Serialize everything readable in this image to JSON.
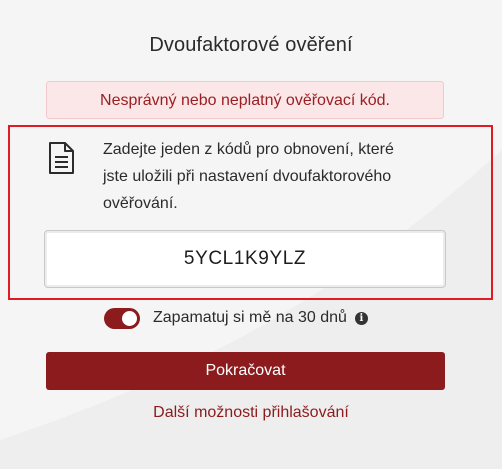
{
  "page": {
    "title": "Dvoufaktorové ověření"
  },
  "alert": {
    "error_text": "Nesprávný nebo neplatný ověřovací kód."
  },
  "recovery": {
    "icon": "document-icon",
    "instruction_line1": "Zadejte jeden z kódů pro obnovení, které",
    "instruction_line2": "jste uložili při nastavení dvoufaktorového",
    "instruction_line3": "ověřování.",
    "code_value": "5YCL1K9YLZ"
  },
  "remember": {
    "label": "Zapamatuj si mě na 30 dnů",
    "checked": true,
    "help_icon": "info-icon"
  },
  "actions": {
    "continue_label": "Pokračovat",
    "more_options_label": "Další možnosti přihlašování"
  },
  "colors": {
    "accent": "#8b1b1d",
    "error_bg": "#fbe7e8",
    "error_text": "#9a1f22",
    "highlight": "#e01b24"
  }
}
